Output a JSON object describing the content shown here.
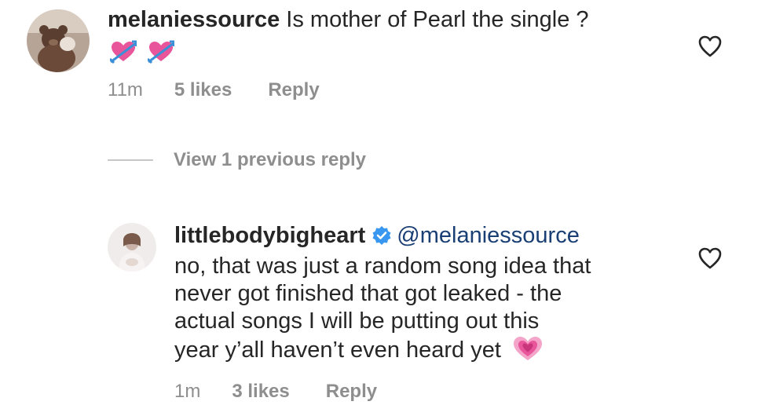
{
  "comments": [
    {
      "username": "melaniessource",
      "text": "Is mother of Pearl the single ?",
      "emoji": [
        "heart-with-arrow-emoji",
        "heart-with-arrow-emoji"
      ],
      "time": "11m",
      "likes": "5 likes",
      "reply_label": "Reply"
    },
    {
      "username": "littlebodybigheart",
      "verified": true,
      "mention": "@melaniessource",
      "text_lines": [
        "no, that was just a random song idea that",
        "never got finished that got leaked - the",
        "actual songs I will be putting out this",
        "year y’all haven’t even heard yet"
      ],
      "emoji": "growing-heart-emoji",
      "time": "1m",
      "likes": "3 likes",
      "reply_label": "Reply"
    }
  ],
  "view_replies_label": "View 1 previous reply",
  "icons": {
    "like": "heart-outline-icon",
    "verified": "verified-badge-icon"
  },
  "colors": {
    "text": "#262626",
    "secondary": "#8e8e8e",
    "mention": "#1a3f74",
    "verified": "#3897f0",
    "emoji_pink": "#e8559a"
  }
}
